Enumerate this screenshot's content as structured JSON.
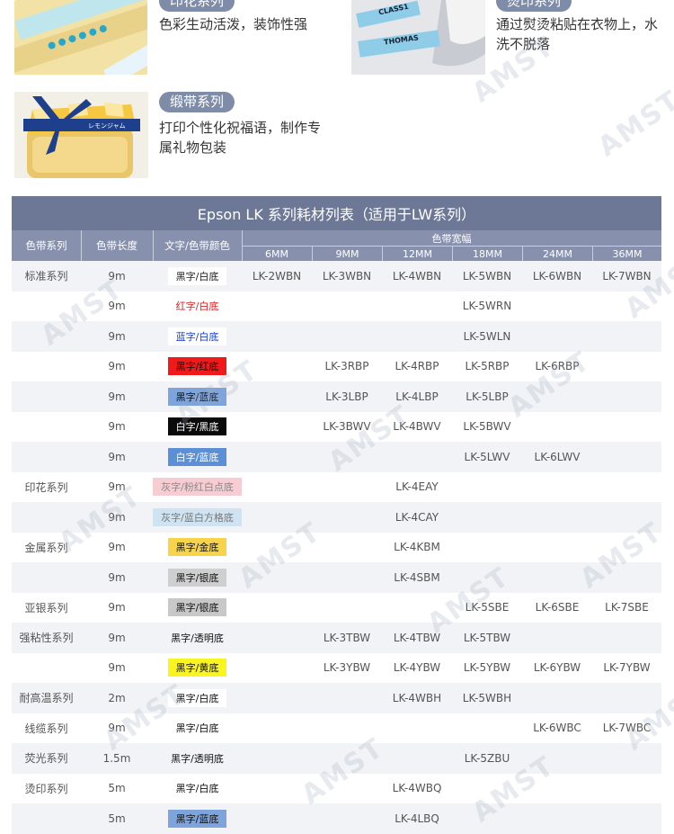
{
  "features": [
    {
      "tag": "印花系列",
      "desc": "色彩生动活泼，装饰性强"
    },
    {
      "tag": "烫印系列",
      "desc": "通过熨烫粘贴在衣物上，水洗不脱落"
    },
    {
      "tag": "缎带系列",
      "desc": "打印个性化祝福语，制作专属礼物包装"
    }
  ],
  "photo_text": {
    "class_label": "CLASS1",
    "name_label": "THOMAS",
    "ribbon_text": "レモンジャム"
  },
  "watermark": "AMST",
  "table": {
    "title": "Epson LK 系列耗材列表（适用于LW系列）",
    "headers": {
      "series": "色带系列",
      "length": "色带长度",
      "color": "文字/色带颜色",
      "width_group": "色带宽幅"
    },
    "widths": [
      "6MM",
      "9MM",
      "12MM",
      "18MM",
      "24MM",
      "36MM"
    ],
    "rows": [
      {
        "series": "标准系列",
        "length": "9m",
        "color": "黑字/白底",
        "swatch_bg": "#ffffff",
        "swatch_fg": "#222222",
        "models": [
          "LK-2WBN",
          "LK-3WBN",
          "LK-4WBN",
          "LK-5WBN",
          "LK-6WBN",
          "LK-7WBN"
        ]
      },
      {
        "series": "",
        "length": "9m",
        "color": "红字/白底",
        "swatch_bg": "#ffffff",
        "swatch_fg": "#e02020",
        "models": [
          "",
          "",
          "",
          "LK-5WRN",
          "",
          ""
        ]
      },
      {
        "series": "",
        "length": "9m",
        "color": "蓝字/白底",
        "swatch_bg": "#ffffff",
        "swatch_fg": "#1a3fd0",
        "models": [
          "",
          "",
          "",
          "LK-5WLN",
          "",
          ""
        ]
      },
      {
        "series": "",
        "length": "9m",
        "color": "黑字/红底",
        "swatch_bg": "#f01a1a",
        "swatch_fg": "#111111",
        "models": [
          "",
          "LK-3RBP",
          "LK-4RBP",
          "LK-5RBP",
          "LK-6RBP",
          ""
        ]
      },
      {
        "series": "",
        "length": "9m",
        "color": "黑字/蓝底",
        "swatch_bg": "#7ea4dc",
        "swatch_fg": "#111111",
        "models": [
          "",
          "LK-3LBP",
          "LK-4LBP",
          "LK-5LBP",
          "",
          ""
        ]
      },
      {
        "series": "",
        "length": "9m",
        "color": "白字/黑底",
        "swatch_bg": "#0a0a0a",
        "swatch_fg": "#ffffff",
        "models": [
          "",
          "LK-3BWV",
          "LK-4BWV",
          "LK-5BWV",
          "",
          ""
        ]
      },
      {
        "series": "",
        "length": "9m",
        "color": "白字/蓝底",
        "swatch_bg": "#5b8fd6",
        "swatch_fg": "#ffffff",
        "models": [
          "",
          "",
          "",
          "LK-5LWV",
          "LK-6LWV",
          ""
        ]
      },
      {
        "series": "印花系列",
        "length": "9m",
        "color": "灰字/粉红白点底",
        "swatch_bg": "#f6cdd3",
        "swatch_fg": "#888888",
        "models": [
          "",
          "",
          "LK-4EAY",
          "",
          "",
          ""
        ]
      },
      {
        "series": "",
        "length": "9m",
        "color": "灰字/蓝白方格底",
        "swatch_bg": "#cfe3f2",
        "swatch_fg": "#777777",
        "models": [
          "",
          "",
          "LK-4CAY",
          "",
          "",
          ""
        ]
      },
      {
        "series": "金属系列",
        "length": "9m",
        "color": "黑字/金底",
        "swatch_bg": "#f7d44a",
        "swatch_fg": "#111111",
        "models": [
          "",
          "",
          "LK-4KBM",
          "",
          "",
          ""
        ]
      },
      {
        "series": "",
        "length": "9m",
        "color": "黑字/银底",
        "swatch_bg": "#cfcfcf",
        "swatch_fg": "#111111",
        "models": [
          "",
          "",
          "LK-4SBM",
          "",
          "",
          ""
        ]
      },
      {
        "series": "亚银系列",
        "length": "9m",
        "color": "黑字/银底",
        "swatch_bg": "#c8c8c8",
        "swatch_fg": "#111111",
        "models": [
          "",
          "",
          "",
          "LK-5SBE",
          "LK-6SBE",
          "LK-7SBE"
        ]
      },
      {
        "series": "强粘性系列",
        "length": "9m",
        "color": "黑字/透明底",
        "swatch_bg": "transparent",
        "swatch_fg": "#111111",
        "models": [
          "",
          "LK-3TBW",
          "LK-4TBW",
          "LK-5TBW",
          "",
          ""
        ]
      },
      {
        "series": "",
        "length": "9m",
        "color": "黑字/黄底",
        "swatch_bg": "#fbf51f",
        "swatch_fg": "#111111",
        "models": [
          "",
          "LK-3YBW",
          "LK-4YBW",
          "LK-5YBW",
          "LK-6YBW",
          "LK-7YBW"
        ]
      },
      {
        "series": "耐高温系列",
        "length": "2m",
        "color": "黑字/白底",
        "swatch_bg": "#ffffff",
        "swatch_fg": "#111111",
        "models": [
          "",
          "",
          "LK-4WBH",
          "LK-5WBH",
          "",
          ""
        ]
      },
      {
        "series": "线缆系列",
        "length": "9m",
        "color": "黑字/白底",
        "swatch_bg": "#ffffff",
        "swatch_fg": "#111111",
        "models": [
          "",
          "",
          "",
          "",
          "LK-6WBC",
          "LK-7WBC"
        ]
      },
      {
        "series": "荧光系列",
        "length": "1.5m",
        "color": "黑字/透明底",
        "swatch_bg": "transparent",
        "swatch_fg": "#111111",
        "models": [
          "",
          "",
          "",
          "LK-5ZBU",
          "",
          ""
        ]
      },
      {
        "series": "烫印系列",
        "length": "5m",
        "color": "黑字/白底",
        "swatch_bg": "#ffffff",
        "swatch_fg": "#111111",
        "models": [
          "",
          "",
          "LK-4WBQ",
          "",
          "",
          ""
        ]
      },
      {
        "series": "",
        "length": "5m",
        "color": "黑字/蓝底",
        "swatch_bg": "#7ea4dc",
        "swatch_fg": "#111111",
        "models": [
          "",
          "",
          "LK-4LBQ",
          "",
          "",
          ""
        ]
      }
    ]
  }
}
